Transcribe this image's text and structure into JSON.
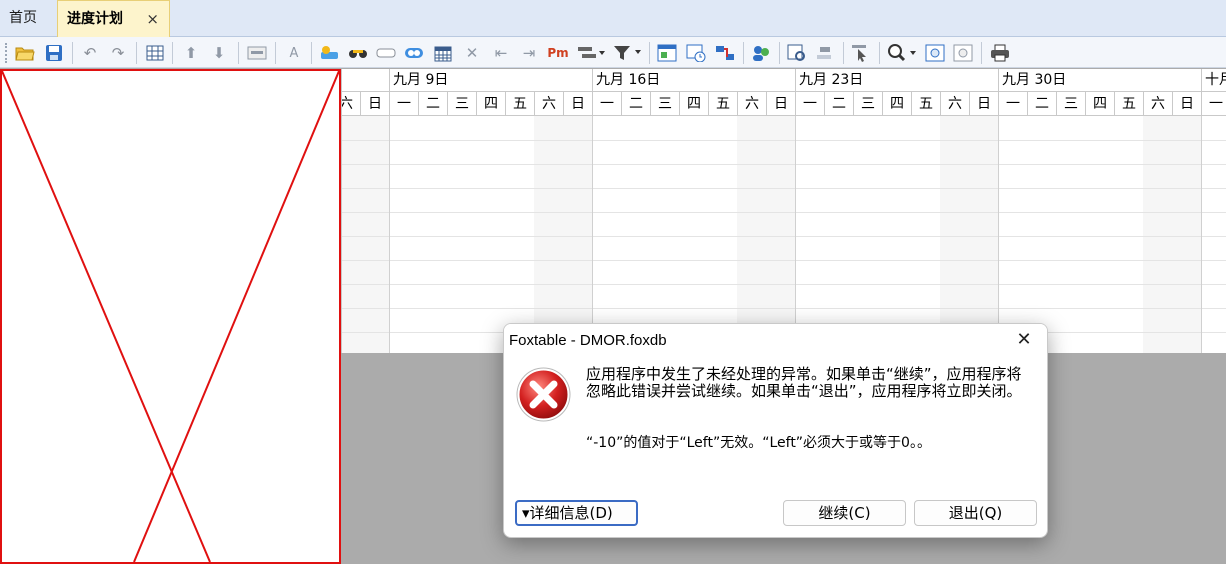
{
  "tabs": {
    "home_label": "首页",
    "active_label": "进度计划",
    "close_glyph": "×"
  },
  "toolbar": {
    "icons": [
      "open-folder-icon",
      "save-icon",
      "undo-icon",
      "redo-icon",
      "column-settings-icon",
      "move-up-icon",
      "move-down-icon",
      "window-icon",
      "font-icon",
      "add-task-icon",
      "link-icon",
      "unlink-icon",
      "toggle-icon",
      "calendar-icon",
      "delete-icon",
      "outdent-icon",
      "indent-icon",
      "milestone-icon",
      "group-dropdown-icon",
      "filter-dropdown-icon",
      "report-icon",
      "timeline-icon",
      "split-icon",
      "resources-icon",
      "critical-path-icon",
      "baseline-icon",
      "select-pointer-icon",
      "zoom-dropdown-icon",
      "zoom-fit-icon",
      "zoom-reset-icon",
      "print-icon"
    ]
  },
  "gantt": {
    "weeks": [
      "九月 9日",
      "九月 16日",
      "九月 23日",
      "九月 30日",
      "十月"
    ],
    "day_labels": [
      "六",
      "日",
      "一",
      "二",
      "三",
      "四",
      "五",
      "六",
      "日",
      "一",
      "二",
      "三",
      "四",
      "五",
      "六",
      "日",
      "一",
      "二",
      "三",
      "四",
      "五",
      "六",
      "日",
      "一",
      "二",
      "三",
      "四",
      "五",
      "六",
      "日",
      "一"
    ]
  },
  "dialog": {
    "title": "Foxtable - DMOR.foxdb",
    "close_glyph": "✕",
    "message": "应用程序中发生了未经处理的异常。如果单击“继续”，应用程序将忽略此错误并尝试继续。如果单击“退出”，应用程序将立即关闭。",
    "detail": "“-10”的值对于“Left”无效。“Left”必须大于或等于0。。",
    "details_button": "▾详细信息(D)",
    "continue_button": "继续(C)",
    "exit_button": "退出(Q)",
    "icon": "error-icon"
  },
  "colors": {
    "active_tab_bg": "#fdf4cc",
    "error_red": "#d32020",
    "placeholder_red": "#e01010"
  }
}
